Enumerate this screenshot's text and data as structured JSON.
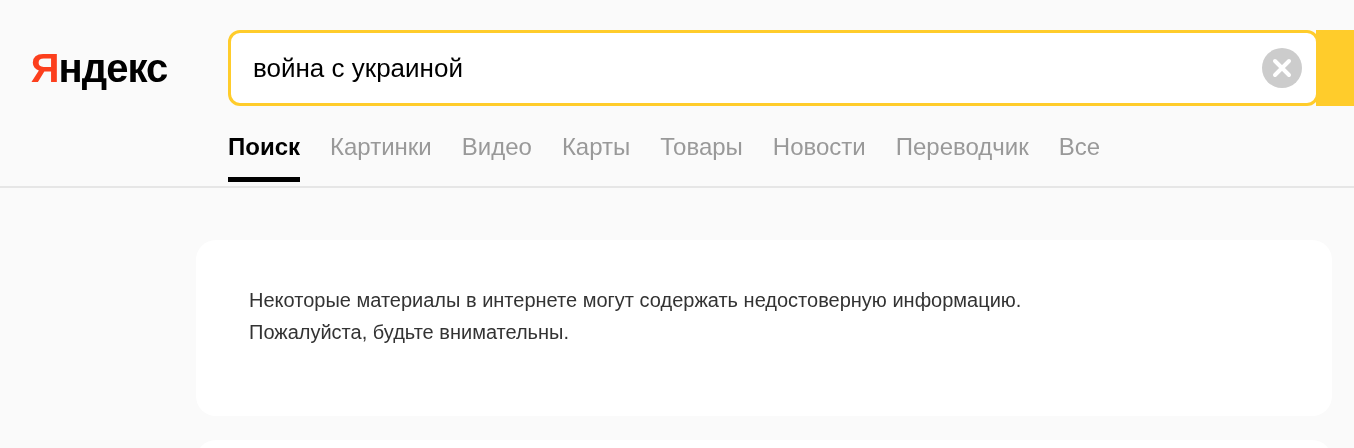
{
  "logo": {
    "text": "Яндекс"
  },
  "search": {
    "value": "война с украиной"
  },
  "tabs": [
    {
      "label": "Поиск",
      "selected": true
    },
    {
      "label": "Картинки",
      "selected": false
    },
    {
      "label": "Видео",
      "selected": false
    },
    {
      "label": "Карты",
      "selected": false
    },
    {
      "label": "Товары",
      "selected": false
    },
    {
      "label": "Новости",
      "selected": false
    },
    {
      "label": "Переводчик",
      "selected": false
    },
    {
      "label": "Все",
      "selected": false
    }
  ],
  "notice": {
    "lines": [
      "Некоторые материалы в интернете могут содержать недостоверную информацию.",
      "Пожалуйста, будьте внимательны."
    ]
  }
}
